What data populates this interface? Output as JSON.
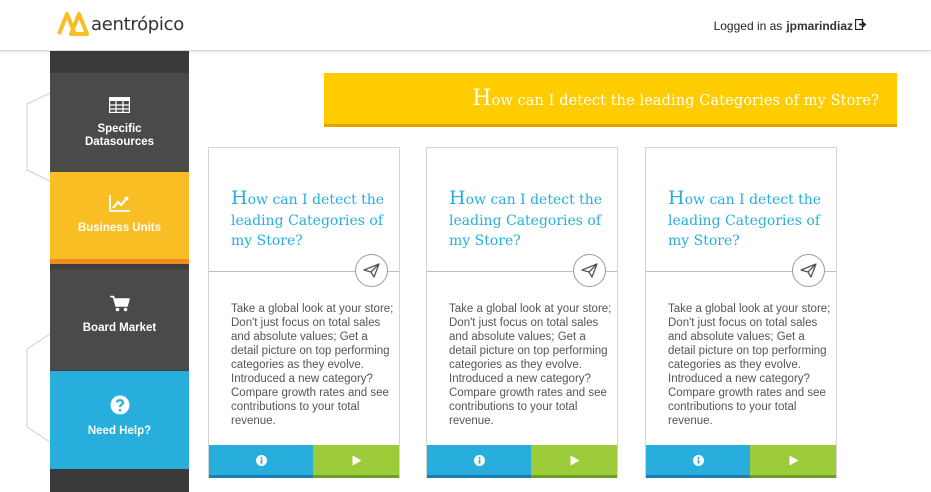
{
  "header": {
    "brand": "aentrópico",
    "logged_in_label": "Logged in as",
    "username": "jpmarindiaz"
  },
  "sidebar": {
    "items": [
      {
        "label_line1": "Specific",
        "label_line2": "Datasources",
        "icon": "table-icon"
      },
      {
        "label": "Business Units",
        "icon": "trend-chart-icon",
        "active": true
      },
      {
        "label": "Board Market",
        "icon": "cart-icon"
      },
      {
        "label": "Need Help?",
        "icon": "question-icon"
      }
    ]
  },
  "banner": {
    "title_first": "H",
    "title_rest": "ow can I detect the leading Categories of my Store?"
  },
  "cards": [
    {
      "title_first": "H",
      "title_rest": "ow can I detect the leading Categories of my Store?",
      "description": "Take a global look at your store; Don't just focus on total sales and absolute values; Get a detail picture on top performing categories as they evolve. Introduced a new category? Compare growth rates and see contributions to your total revenue."
    },
    {
      "title_first": "H",
      "title_rest": "ow can I detect the leading Categories of my Store?",
      "description": "Take a global look at your store; Don't just focus on total sales and absolute values; Get a detail picture on top performing categories as they evolve. Introduced a new category? Compare growth rates and see contributions to your total revenue."
    },
    {
      "title_first": "H",
      "title_rest": "ow can I detect the leading Categories of my Store?",
      "description": "Take a global look at your store; Don't just focus on total sales and absolute values; Get a detail picture on top performing categories as they evolve. Introduced a new category? Compare growth rates and see contributions to your total revenue."
    }
  ],
  "colors": {
    "accent_yellow": "#ffcc00",
    "accent_blue": "#27aedc",
    "accent_green": "#9ccc3a",
    "sidebar_dark": "#4a4a4a",
    "business_units": "#f9be23"
  }
}
